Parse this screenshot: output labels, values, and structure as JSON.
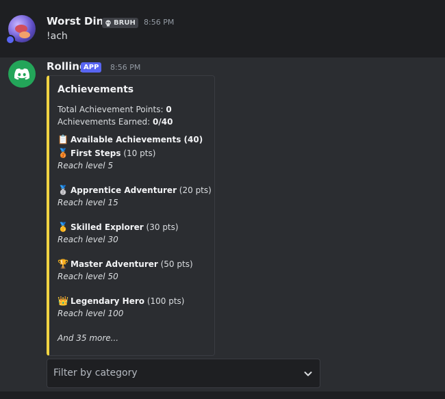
{
  "messages": [
    {
      "author": "Worst Dino",
      "role_tag": "BRUH",
      "role_icon": "skull-icon",
      "time": "8:56 PM",
      "text": "!ach"
    },
    {
      "author": "Rolling",
      "tag": "APP",
      "time": "8:56 PM",
      "avatar_icon": "discord-logo-icon"
    }
  ],
  "embed": {
    "accent_color": "#f0d442",
    "title": "Achievements",
    "points_label": "Total Achievement Points: ",
    "points_value": "0",
    "earned_label": "Achievements Earned: ",
    "earned_value": "0/40",
    "available_icon": "📋",
    "available_text": "Available Achievements (40)",
    "items": [
      {
        "icon": "🥉",
        "name": "First Steps",
        "points": " (10 pts)",
        "desc": "Reach level 5"
      },
      {
        "icon": "🥈",
        "name": "Apprentice Adventurer",
        "points": " (20 pts)",
        "desc": "Reach level 15"
      },
      {
        "icon": "🥇",
        "name": "Skilled Explorer",
        "points": " (30 pts)",
        "desc": "Reach level 30"
      },
      {
        "icon": "🏆",
        "name": "Master Adventurer",
        "points": " (50 pts)",
        "desc": "Reach level 50"
      },
      {
        "icon": "👑",
        "name": "Legendary Hero",
        "points": " (100 pts)",
        "desc": "Reach level 100"
      }
    ],
    "more_text": "And 35 more..."
  },
  "select": {
    "placeholder": "Filter by category",
    "icon": "chevron-down-icon"
  }
}
